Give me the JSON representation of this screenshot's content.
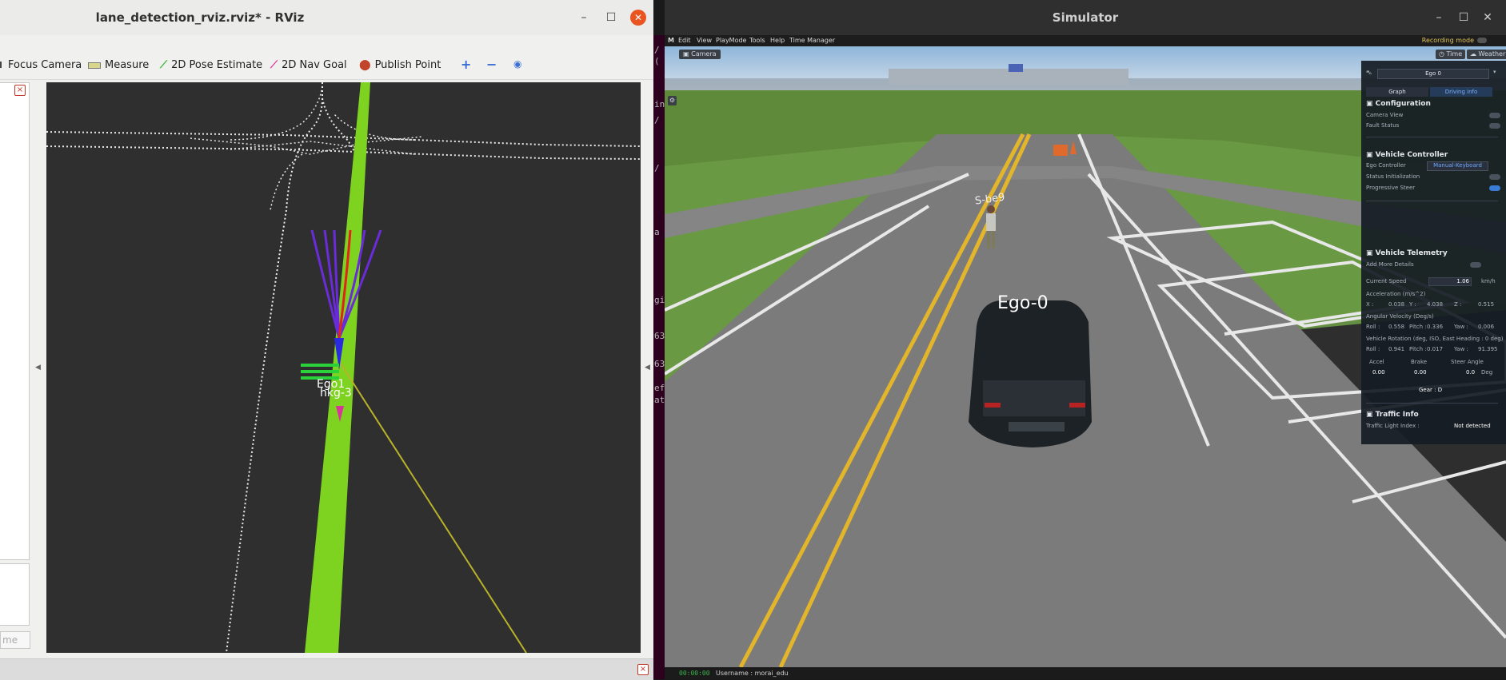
{
  "rviz": {
    "title": "lane_detection_rviz.rviz* - RViz",
    "window_controls": {
      "minimize": "–",
      "maximize": "☐",
      "close": "✕"
    },
    "toolbar": {
      "focus_camera": "Focus Camera",
      "measure": "Measure",
      "pose_estimate": "2D Pose Estimate",
      "nav_goal": "2D Nav Goal",
      "publish_point": "Publish Point",
      "plus": "+",
      "minus": "−",
      "eye": "◉"
    },
    "name_field_placeholder": "me",
    "overlay_text": "Ego1",
    "overlay_text2": "hkg-3",
    "colors": {
      "lane_green": "#7ed321",
      "path_purple": "#6a2bd9",
      "path_red": "#e2231a",
      "bg": "#2f2f2f"
    }
  },
  "terminal": {
    "chars": [
      "/",
      "(",
      "in",
      "/",
      "/",
      "/",
      "5",
      "5",
      "a",
      "e",
      "c",
      "C",
      "/",
      "gi",
      "a",
      "63",
      "63",
      "ef",
      "at"
    ]
  },
  "simulator": {
    "title": "Simulator",
    "window_controls": {
      "minimize": "–",
      "maximize": "☐",
      "close": "✕"
    },
    "menu": [
      "M",
      "Edit",
      "View",
      "PlayMode",
      "Tools",
      "Help",
      "Time Manager"
    ],
    "recording_mode": "Recording mode",
    "camera_button": "Camera",
    "time_button": "Time",
    "weather_button": "Weather",
    "ego_label": "Ego-0",
    "ped_label": "S-be9",
    "status": {
      "time": "00:00:00",
      "username": "Username : morai_edu"
    },
    "panel": {
      "selected_vehicle": "Ego 0",
      "tabs": [
        "Graph",
        "Driving info"
      ],
      "configuration": {
        "title": "Configuration",
        "camera_view": "Camera View",
        "fault_status": "Fault Status"
      },
      "vehicle_controller": {
        "title": "Vehicle Controller",
        "ego_controller": "Ego Controller",
        "ego_controller_value": "Manual-Keyboard",
        "status_init": "Status Initialization",
        "progressive_steer": "Progressive Steer"
      },
      "vehicle_telemetry": {
        "title": "Vehicle Telemetry",
        "add_more": "Add More Details",
        "current_speed": "Current Speed",
        "current_speed_value": "1.06",
        "current_speed_unit": "km/h",
        "acceleration": "Acceleration (m/s^2)",
        "acc_x": "X :",
        "acc_x_val": "0.038",
        "acc_y": "Y :",
        "acc_y_val": "4.038",
        "acc_z": "Z :",
        "acc_z_val": "0.515",
        "angular_velocity": "Angular Velocity (Deg/s)",
        "av_roll": "Roll :",
        "av_roll_val": "0.558",
        "av_pitch": "Pitch :",
        "av_pitch_val": "0.336",
        "av_yaw": "Yaw :",
        "av_yaw_val": "0.006",
        "vehicle_rotation": "Vehicle Rotation (deg, ISO, East Heading : 0 deg)",
        "vr_roll": "Roll :",
        "vr_roll_val": "0.941",
        "vr_pitch": "Pitch :",
        "vr_pitch_val": "0.017",
        "vr_yaw": "Yaw :",
        "vr_yaw_val": "91.395",
        "accel_label": "Accel",
        "brake_label": "Brake",
        "steer_label": "Steer Angle",
        "accel_val": "0.00",
        "brake_val": "0.00",
        "steer_val": "0.0",
        "steer_unit": "Deg",
        "gear": "Gear : D"
      },
      "traffic_info": {
        "title": "Traffic Info",
        "traffic_light_index": "Traffic Light Index :",
        "traffic_light_value": "Not detected"
      }
    }
  }
}
